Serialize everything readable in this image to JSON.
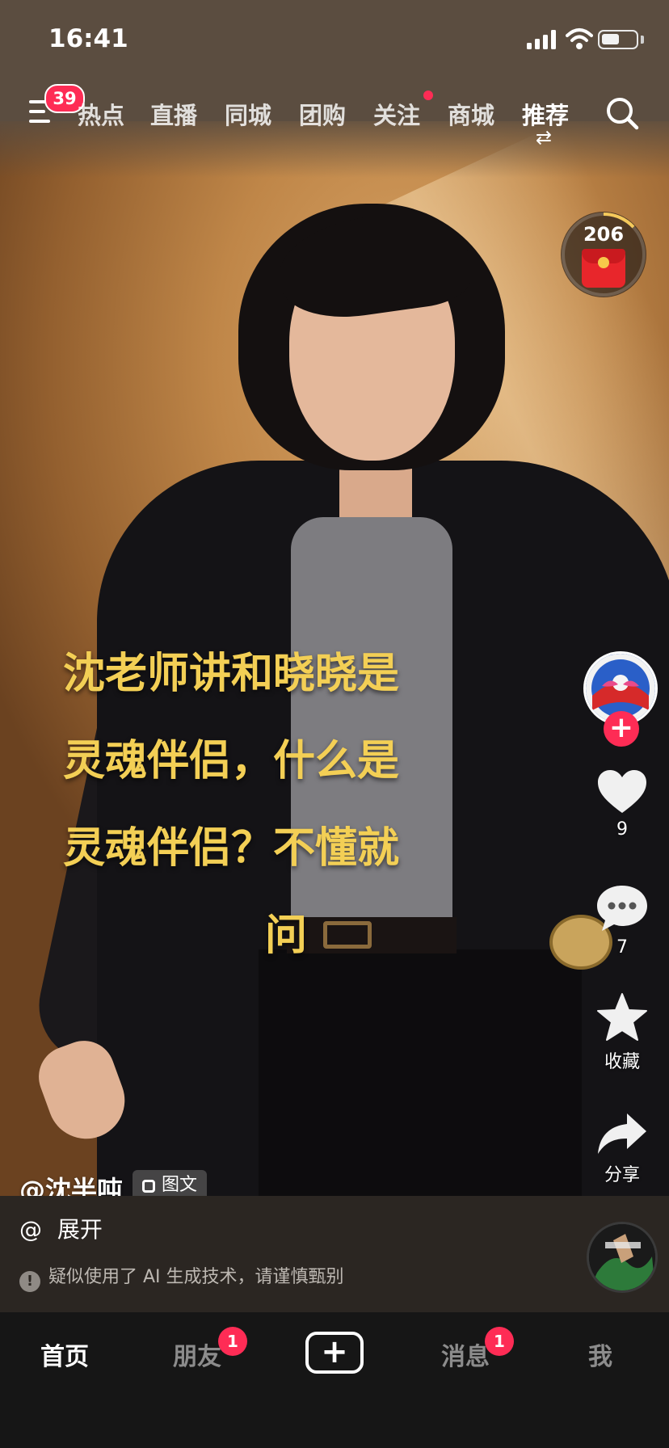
{
  "status_bar": {
    "time": "16:41",
    "battery_level": 0.55
  },
  "top_nav": {
    "menu_badge": "39",
    "tabs": [
      "热点",
      "直播",
      "同城",
      "团购",
      "关注",
      "商城",
      "推荐"
    ],
    "active_tab": "推荐",
    "follow_has_dot": true,
    "icons": [
      "menu-icon",
      "switch-icon",
      "search-icon"
    ]
  },
  "red_packet": {
    "count": "206"
  },
  "caption": {
    "lines": [
      "沈老师讲和晓晓是",
      "灵魂伴侣，什么是",
      "灵魂伴侣？不懂就",
      "问"
    ]
  },
  "right_rail": {
    "like_count": "9",
    "comment_count": "7",
    "favorite_label": "收藏",
    "share_label": "分享"
  },
  "post": {
    "author": "@沈半吨",
    "type_tag": "图文",
    "mention": "@",
    "expand_label": "展开",
    "ai_notice": "疑似使用了 AI 生成技术，请谨慎甄别"
  },
  "tab_bar": {
    "home": "首页",
    "friends": "朋友",
    "friends_badge": "1",
    "messages": "消息",
    "messages_badge": "1",
    "me": "我"
  },
  "colors": {
    "accent": "#fe2c55",
    "caption": "#f3cf55",
    "tab_bg": "#161616"
  }
}
